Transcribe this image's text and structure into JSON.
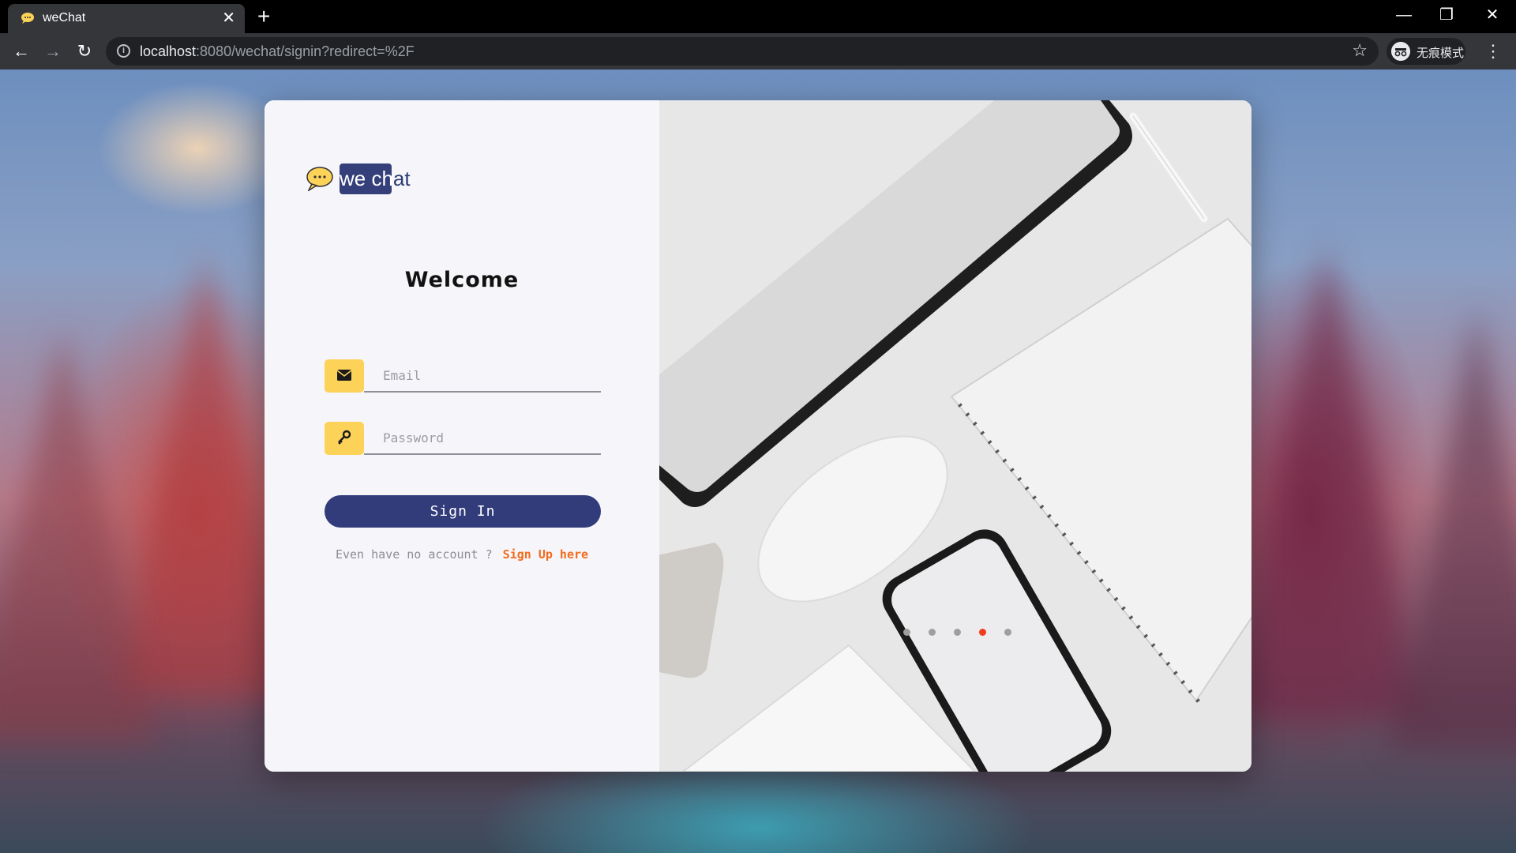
{
  "browser": {
    "tab_title": "weChat",
    "tab_close": "✕",
    "new_tab": "+",
    "url_host": "localhost",
    "url_rest": ":8080/wechat/signin?redirect=%2F",
    "incognito_label": "无痕模式",
    "window_controls": {
      "minimize": "—",
      "maximize": "❐",
      "close": "✕"
    },
    "nav": {
      "back": "←",
      "forward": "→",
      "reload": "↻",
      "star": "☆",
      "menu": "⋮",
      "info": "i"
    }
  },
  "login": {
    "logo_part1": "we ch",
    "logo_part2": "at",
    "welcome": "Welcome",
    "email_placeholder": "Email",
    "password_placeholder": "Password",
    "signin_label": "Sign In",
    "signup_prompt": "Even have no account ?",
    "signup_link": "Sign Up here"
  },
  "carousel": {
    "slide_count": 5,
    "active_index": 3
  },
  "colors": {
    "brand": "#323c7a",
    "accent_yellow": "#fcd258",
    "link_orange": "#f26b1d",
    "active_dot": "#f13b1c"
  },
  "icons": [
    "chat-bubble-icon",
    "envelope-icon",
    "key-icon",
    "star-icon",
    "incognito-icon",
    "kebab-menu-icon"
  ]
}
